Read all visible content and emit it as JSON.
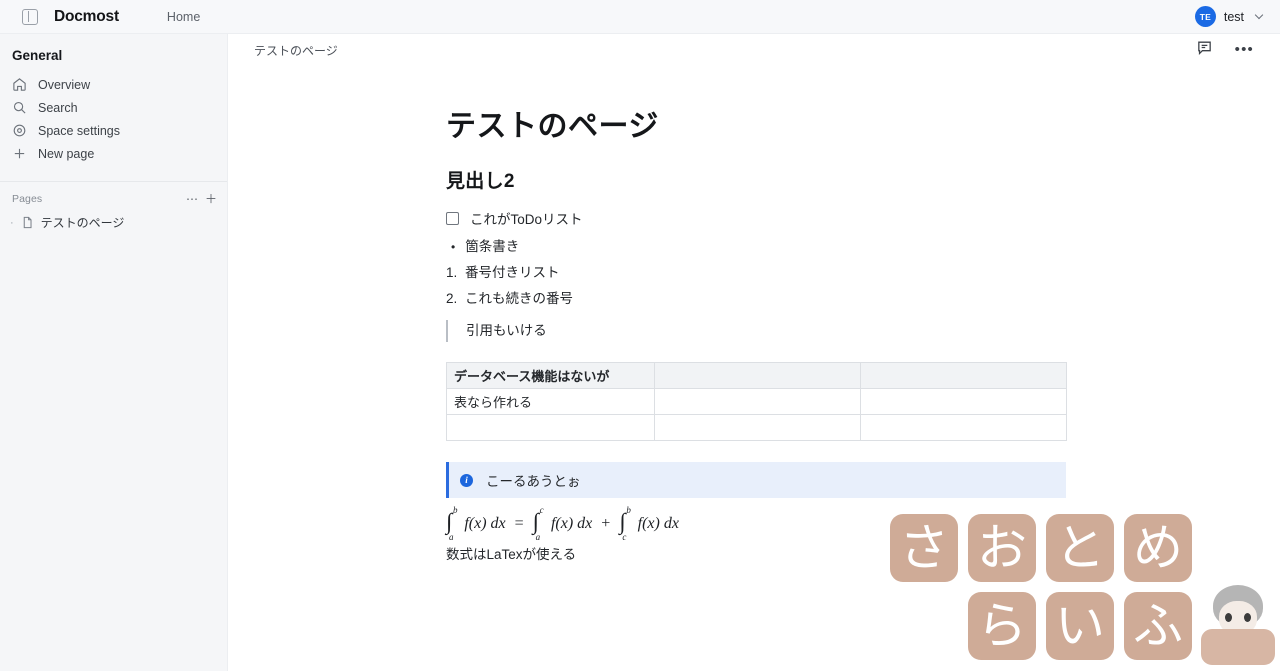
{
  "topbar": {
    "panel_toggle_icon": "sidebar-toggle-icon",
    "brand": "Docmost",
    "home_label": "Home",
    "user": {
      "initials": "TE",
      "name": "test",
      "avatar_color": "#1b6ae4"
    }
  },
  "sidebar": {
    "space_title": "General",
    "items": [
      {
        "label": "Overview",
        "icon": "home-icon"
      },
      {
        "label": "Search",
        "icon": "search-icon"
      },
      {
        "label": "Space settings",
        "icon": "gear-icon"
      },
      {
        "label": "New page",
        "icon": "plus-icon"
      }
    ],
    "pages_section": {
      "label": "Pages",
      "more_icon": "ellipsis-icon",
      "add_icon": "plus-icon",
      "tree": [
        {
          "label": "テストのページ",
          "icon": "document-icon",
          "bullet": "·"
        }
      ]
    }
  },
  "content_header": {
    "breadcrumb": "テストのページ",
    "comment_icon": "comment-icon",
    "more_icon": "ellipsis-icon"
  },
  "document": {
    "title": "テストのページ",
    "heading2": "見出し2",
    "todo": {
      "text": "これがToDoリスト",
      "checked": false
    },
    "bullet": {
      "marker": "•",
      "text": "箇条書き"
    },
    "ordered": [
      {
        "marker": "1.",
        "text": "番号付きリスト"
      },
      {
        "marker": "2.",
        "text": "これも続きの番号"
      }
    ],
    "quote": "引用もいける",
    "table": {
      "header": [
        "データベース機能はないが",
        "",
        ""
      ],
      "rows": [
        [
          "表なら作れる",
          "",
          ""
        ],
        [
          "",
          "",
          ""
        ]
      ]
    },
    "callout": {
      "icon": "info-icon",
      "text": "こーるあうとぉ",
      "accent": "#2b6cdf",
      "background": "#e8effb"
    },
    "formula": {
      "lhs": {
        "integral": "∫",
        "lower": "a",
        "upper": "b",
        "body": "f(x) dx"
      },
      "equals": "=",
      "term1": {
        "integral": "∫",
        "lower": "a",
        "upper": "c",
        "body": "f(x) dx"
      },
      "plus": "+",
      "term2": {
        "integral": "∫",
        "lower": "c",
        "upper": "b",
        "body": "f(x) dx"
      }
    },
    "latex_note": "数式はLaTexが使える"
  },
  "decoration": {
    "tile_color": "#cfab97",
    "row1": [
      "さ",
      "お",
      "と",
      "め"
    ],
    "row2": [
      "ら",
      "い",
      "ふ"
    ],
    "mascot": "character-illustration"
  }
}
